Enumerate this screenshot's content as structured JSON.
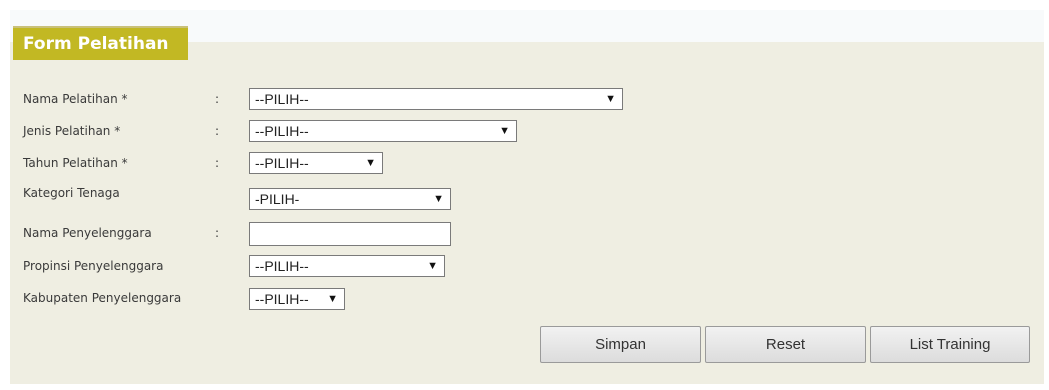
{
  "form": {
    "title": "Form Pelatihan",
    "colon": ":",
    "fields": [
      {
        "label": "Nama Pelatihan *",
        "value": "--PILIH--"
      },
      {
        "label": "Jenis Pelatihan *",
        "value": "--PILIH--"
      },
      {
        "label": "Tahun Pelatihan *",
        "value": "--PILIH--"
      },
      {
        "label": "Kategori Tenaga",
        "value": "-PILIH-"
      },
      {
        "label": "Nama Penyelenggara",
        "value": ""
      },
      {
        "label": "Propinsi Penyelenggara",
        "value": "--PILIH--"
      },
      {
        "label": "Kabupaten Penyelenggara",
        "value": "--PILIH--"
      }
    ],
    "dropdown_arrow": "▼"
  },
  "buttons": {
    "save": "Simpan",
    "reset": "Reset",
    "list": "List Training"
  },
  "colors": {
    "panel_bg": "#efeee2",
    "tab_bg": "#c2b823"
  }
}
